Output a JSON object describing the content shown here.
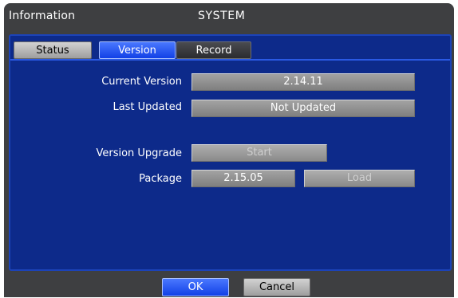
{
  "window": {
    "title": "Information",
    "section": "SYSTEM"
  },
  "tabs": [
    {
      "label": "Status",
      "state": "inactive"
    },
    {
      "label": "Version",
      "state": "active"
    },
    {
      "label": "Record",
      "state": "inactive"
    }
  ],
  "fields": {
    "current_version": {
      "label": "Current Version",
      "value": "2.14.11"
    },
    "last_updated": {
      "label": "Last Updated",
      "value": "Not Updated"
    },
    "version_upgrade": {
      "label": "Version Upgrade",
      "button": "Start"
    },
    "package": {
      "label": "Package",
      "value": "2.15.05",
      "button": "Load"
    }
  },
  "dialog_buttons": {
    "ok": "OK",
    "cancel": "Cancel"
  },
  "colors": {
    "panel": "#0d2a8a",
    "panel_border": "#1c43b8",
    "accent": "#1140e6",
    "chrome": "#3e3f41"
  }
}
